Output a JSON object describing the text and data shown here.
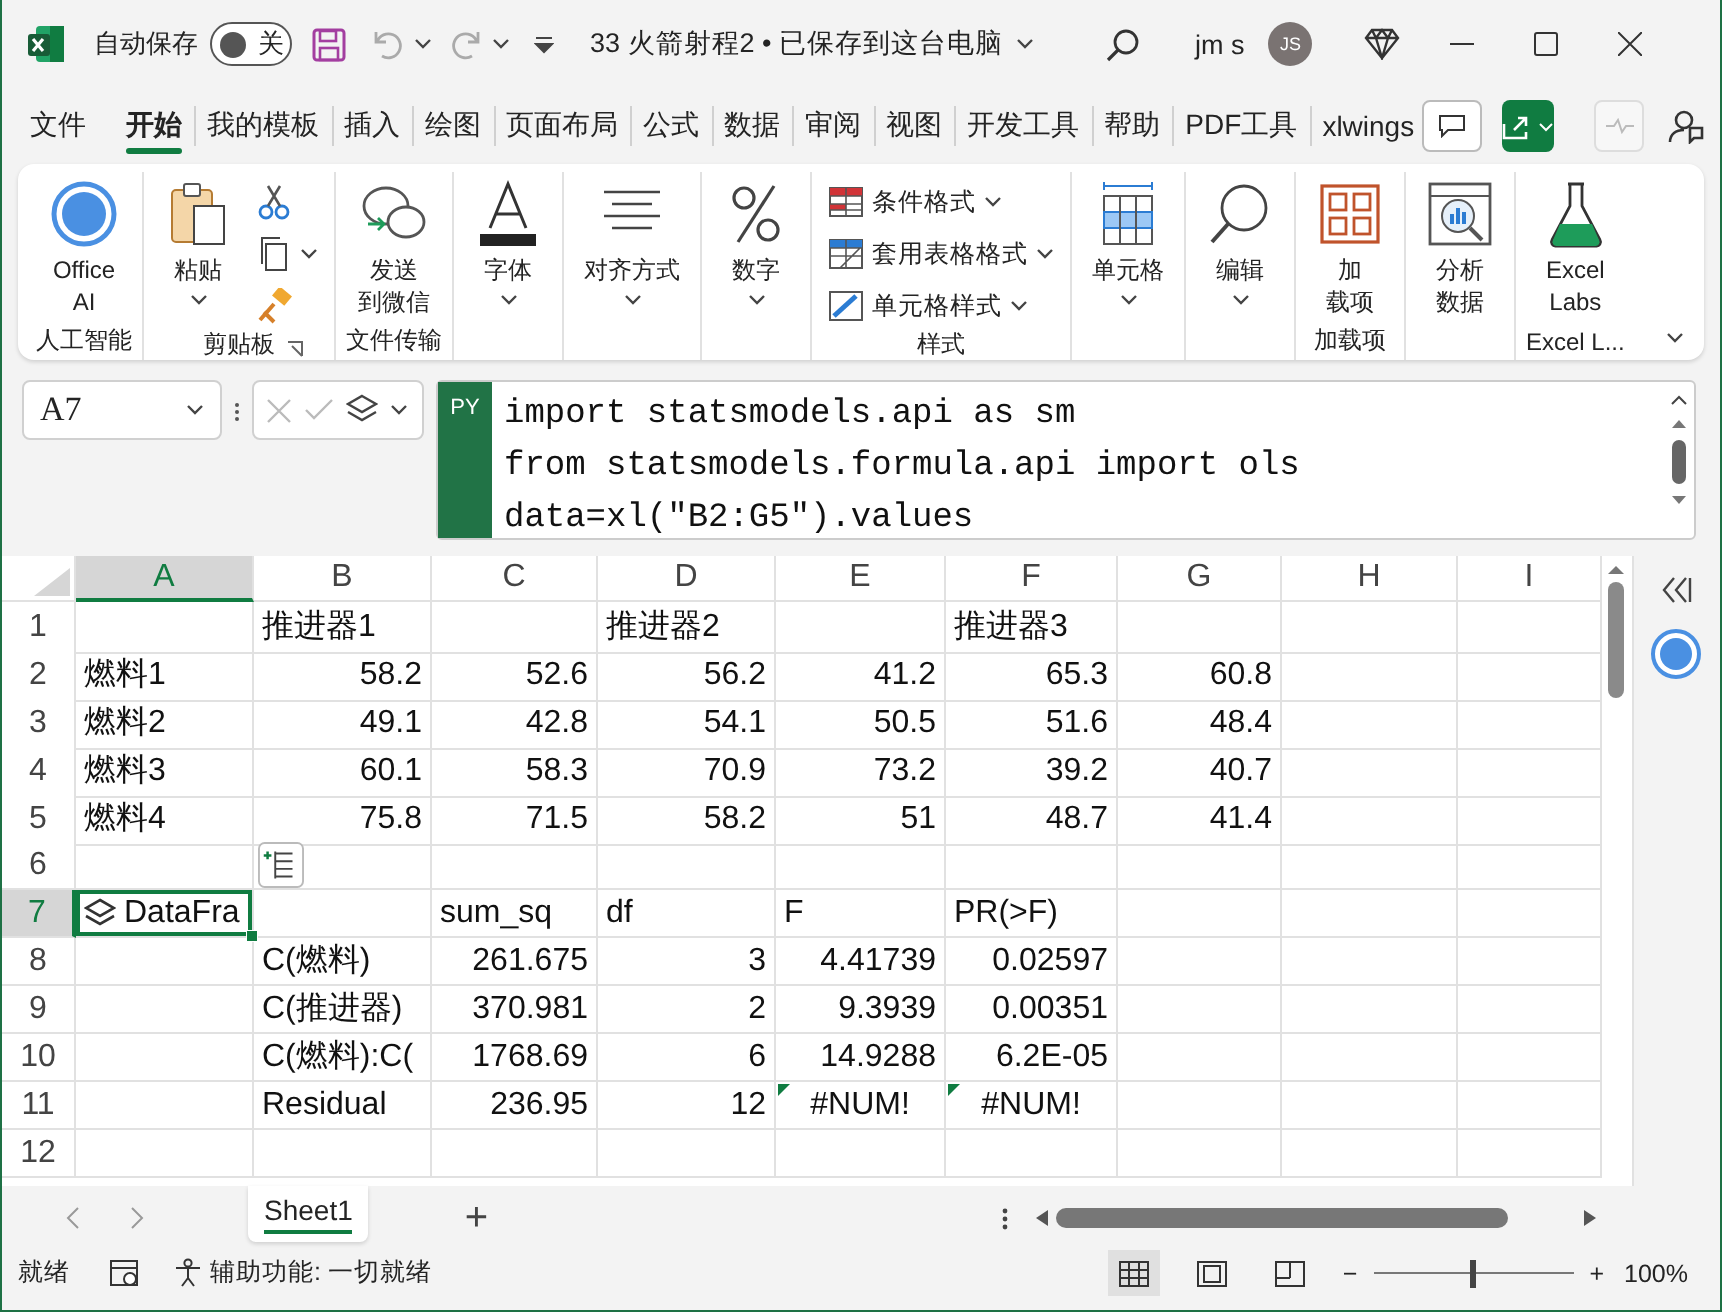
{
  "title_bar": {
    "autosave_label": "自动保存",
    "autosave_on": false,
    "autosave_state": "关",
    "document_title": "33 火箭射程2 • 已保存到这台电脑",
    "user_name": "jm s",
    "user_initials": "JS"
  },
  "menu_tabs": [
    {
      "label": "文件",
      "selected": false
    },
    {
      "label": "开始",
      "selected": true
    },
    {
      "label": "我的模板",
      "selected": false
    },
    {
      "label": "插入",
      "selected": false
    },
    {
      "label": "绘图",
      "selected": false
    },
    {
      "label": "页面布局",
      "selected": false
    },
    {
      "label": "公式",
      "selected": false
    },
    {
      "label": "数据",
      "selected": false
    },
    {
      "label": "审阅",
      "selected": false
    },
    {
      "label": "视图",
      "selected": false
    },
    {
      "label": "开发工具",
      "selected": false
    },
    {
      "label": "帮助",
      "selected": false
    },
    {
      "label": "PDF工具",
      "selected": false
    },
    {
      "label": "xlwings",
      "selected": false
    }
  ],
  "ribbon": {
    "groups": [
      {
        "label": "人工智能",
        "items": [
          {
            "kind": "large",
            "lines": [
              "Office",
              "AI"
            ]
          }
        ]
      },
      {
        "label": "剪贴板",
        "launcher": true,
        "items": [
          {
            "kind": "large",
            "lines": [
              "粘贴"
            ],
            "dropdown": true
          },
          {
            "kind": "small"
          },
          {
            "kind": "small",
            "dropdown": true
          },
          {
            "kind": "small"
          }
        ]
      },
      {
        "label": "文件传输",
        "items": [
          {
            "kind": "large",
            "lines": [
              "发送",
              "到微信"
            ]
          }
        ]
      },
      {
        "items": [
          {
            "kind": "large",
            "lines": [
              "字体"
            ],
            "dropdown": true
          }
        ]
      },
      {
        "items": [
          {
            "kind": "large",
            "lines": [
              "对齐方式"
            ],
            "dropdown": true
          }
        ]
      },
      {
        "items": [
          {
            "kind": "large",
            "lines": [
              "数字"
            ],
            "dropdown": true
          }
        ]
      },
      {
        "label": "样式",
        "items": [
          {
            "kind": "small",
            "lines": [
              "条件格式"
            ],
            "dropdown": true
          },
          {
            "kind": "small",
            "lines": [
              "套用表格格式"
            ],
            "dropdown": true
          },
          {
            "kind": "small",
            "lines": [
              "单元格样式"
            ],
            "dropdown": true
          }
        ]
      },
      {
        "items": [
          {
            "kind": "large",
            "lines": [
              "单元格"
            ],
            "dropdown": true
          }
        ]
      },
      {
        "items": [
          {
            "kind": "large",
            "lines": [
              "编辑"
            ],
            "dropdown": true
          }
        ]
      },
      {
        "label": "加载项",
        "items": [
          {
            "kind": "large",
            "lines": [
              "加",
              "载项"
            ]
          }
        ]
      },
      {
        "items": [
          {
            "kind": "large",
            "lines": [
              "分析",
              "数据"
            ]
          }
        ]
      },
      {
        "label": "Excel L...",
        "items": [
          {
            "kind": "large",
            "lines": [
              "Excel",
              "Labs"
            ]
          }
        ]
      }
    ]
  },
  "formula_bar": {
    "name_box": "A7",
    "badge": "PY",
    "code_lines": [
      "import statsmodels.api as sm",
      "from statsmodels.formula.api import ols",
      "data=xl(\"B2:G5\").values"
    ]
  },
  "sheet": {
    "columns": [
      {
        "label": "A",
        "selected": true
      },
      {
        "label": "B",
        "selected": false
      },
      {
        "label": "C",
        "selected": false
      },
      {
        "label": "D",
        "selected": false
      },
      {
        "label": "E",
        "selected": false
      },
      {
        "label": "F",
        "selected": false
      },
      {
        "label": "G",
        "selected": false
      },
      {
        "label": "H",
        "selected": false
      },
      {
        "label": "I",
        "selected": false
      }
    ],
    "rows": [
      {
        "label": "1",
        "selected": false,
        "cells": [
          null,
          {
            "text": "推进器1",
            "kind": "text",
            "selected": false
          },
          null,
          {
            "text": "推进器2",
            "kind": "text",
            "selected": false
          },
          null,
          {
            "text": "推进器3",
            "kind": "text",
            "selected": false
          },
          null,
          null,
          null
        ]
      },
      {
        "label": "2",
        "selected": false,
        "cells": [
          {
            "text": "燃料1",
            "kind": "text",
            "selected": false
          },
          {
            "text": "58.2",
            "kind": "number",
            "selected": false
          },
          {
            "text": "52.6",
            "kind": "number",
            "selected": false
          },
          {
            "text": "56.2",
            "kind": "number",
            "selected": false
          },
          {
            "text": "41.2",
            "kind": "number",
            "selected": false
          },
          {
            "text": "65.3",
            "kind": "number",
            "selected": false
          },
          {
            "text": "60.8",
            "kind": "number",
            "selected": false
          },
          null,
          null
        ]
      },
      {
        "label": "3",
        "selected": false,
        "cells": [
          {
            "text": "燃料2",
            "kind": "text",
            "selected": false
          },
          {
            "text": "49.1",
            "kind": "number",
            "selected": false
          },
          {
            "text": "42.8",
            "kind": "number",
            "selected": false
          },
          {
            "text": "54.1",
            "kind": "number",
            "selected": false
          },
          {
            "text": "50.5",
            "kind": "number",
            "selected": false
          },
          {
            "text": "51.6",
            "kind": "number",
            "selected": false
          },
          {
            "text": "48.4",
            "kind": "number",
            "selected": false
          },
          null,
          null
        ]
      },
      {
        "label": "4",
        "selected": false,
        "cells": [
          {
            "text": "燃料3",
            "kind": "text",
            "selected": false
          },
          {
            "text": "60.1",
            "kind": "number",
            "selected": false
          },
          {
            "text": "58.3",
            "kind": "number",
            "selected": false
          },
          {
            "text": "70.9",
            "kind": "number",
            "selected": false
          },
          {
            "text": "73.2",
            "kind": "number",
            "selected": false
          },
          {
            "text": "39.2",
            "kind": "number",
            "selected": false
          },
          {
            "text": "40.7",
            "kind": "number",
            "selected": false
          },
          null,
          null
        ]
      },
      {
        "label": "5",
        "selected": false,
        "cells": [
          {
            "text": "燃料4",
            "kind": "text",
            "selected": false
          },
          {
            "text": "75.8",
            "kind": "number",
            "selected": false
          },
          {
            "text": "71.5",
            "kind": "number",
            "selected": false
          },
          {
            "text": "58.2",
            "kind": "number",
            "selected": false
          },
          {
            "text": "51",
            "kind": "number",
            "selected": false
          },
          {
            "text": "48.7",
            "kind": "number",
            "selected": false
          },
          {
            "text": "41.4",
            "kind": "number",
            "selected": false
          },
          null,
          null
        ]
      },
      {
        "label": "6",
        "selected": false,
        "cells": [
          null,
          null,
          null,
          null,
          null,
          null,
          null,
          null,
          null
        ]
      },
      {
        "label": "7",
        "selected": true,
        "cells": [
          {
            "text": "DataFra",
            "kind": "python_object",
            "selected": true
          },
          null,
          {
            "text": "sum_sq",
            "kind": "text",
            "selected": false
          },
          {
            "text": "df",
            "kind": "text",
            "selected": false
          },
          {
            "text": "F",
            "kind": "text",
            "selected": false
          },
          {
            "text": "PR(>F)",
            "kind": "text",
            "selected": false
          },
          null,
          null,
          null
        ]
      },
      {
        "label": "8",
        "selected": false,
        "cells": [
          null,
          {
            "text": "C(燃料)",
            "kind": "text",
            "selected": false
          },
          {
            "text": "261.675",
            "kind": "number",
            "selected": false
          },
          {
            "text": "3",
            "kind": "number",
            "selected": false
          },
          {
            "text": "4.41739",
            "kind": "number",
            "selected": false
          },
          {
            "text": "0.02597",
            "kind": "number",
            "selected": false
          },
          null,
          null,
          null
        ]
      },
      {
        "label": "9",
        "selected": false,
        "cells": [
          null,
          {
            "text": "C(推进器)",
            "kind": "text",
            "selected": false
          },
          {
            "text": "370.981",
            "kind": "number",
            "selected": false
          },
          {
            "text": "2",
            "kind": "number",
            "selected": false
          },
          {
            "text": "9.3939",
            "kind": "number",
            "selected": false
          },
          {
            "text": "0.00351",
            "kind": "number",
            "selected": false
          },
          null,
          null,
          null
        ]
      },
      {
        "label": "10",
        "selected": false,
        "cells": [
          null,
          {
            "text": "C(燃料):C(",
            "kind": "text",
            "selected": false
          },
          {
            "text": "1768.69",
            "kind": "number",
            "selected": false
          },
          {
            "text": "6",
            "kind": "number",
            "selected": false
          },
          {
            "text": "14.9288",
            "kind": "number",
            "selected": false
          },
          {
            "text": "6.2E-05",
            "kind": "number",
            "selected": false
          },
          null,
          null,
          null
        ]
      },
      {
        "label": "11",
        "selected": false,
        "cells": [
          null,
          {
            "text": "Residual",
            "kind": "text",
            "selected": false
          },
          {
            "text": "236.95",
            "kind": "number",
            "selected": false
          },
          {
            "text": "12",
            "kind": "number",
            "selected": false
          },
          {
            "text": "#NUM!",
            "kind": "error",
            "selected": false,
            "error_flag": true
          },
          {
            "text": "#NUM!",
            "kind": "error",
            "selected": false,
            "error_flag": true
          },
          null,
          null,
          null
        ]
      },
      {
        "label": "12",
        "selected": false,
        "cells": [
          null,
          null,
          null,
          null,
          null,
          null,
          null,
          null,
          null
        ]
      }
    ]
  },
  "sheet_tabs": {
    "tabs": [
      {
        "label": "Sheet1",
        "selected": true
      }
    ],
    "add": "+"
  },
  "status_bar": {
    "status": "就绪",
    "accessibility": "辅助功能: 一切就绪",
    "views": [
      {
        "selected": true
      },
      {
        "selected": false
      },
      {
        "selected": false
      }
    ],
    "zoom_out": "−",
    "zoom_in": "+",
    "zoom": {
      "level": 0.5,
      "label": "100%"
    }
  }
}
